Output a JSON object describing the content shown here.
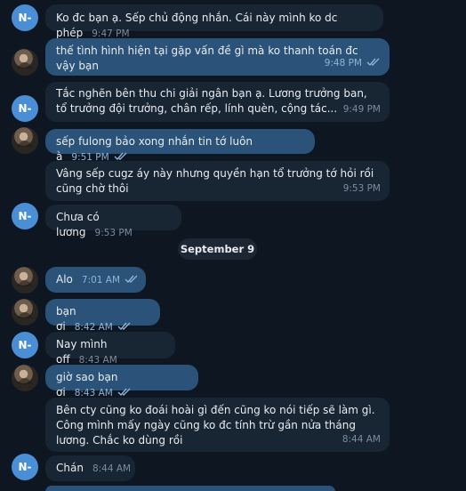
{
  "messages": [
    {
      "sender": "N-",
      "text": "Ko đc bạn ạ. Sếp chủ động nhắn. Cái này mình ko dc phép",
      "time": "9:47 PM"
    },
    {
      "sender": "me",
      "text": "thế tình hình hiện tại gặp vấn đề gì mà ko thanh toán đc vậy bạn",
      "time": "9:48 PM",
      "status": "read"
    },
    {
      "sender": "N-",
      "text": "Tắc nghẽn bên thu chi giải ngân bạn ạ. Lương trưởng ban, tổ trưởng đội trưởng, chân rếp, lính quèn, cộng tác...",
      "time": "9:49 PM"
    },
    {
      "sender": "me",
      "text": "sếp fulong bảo xong nhắn tin tớ luôn à",
      "time": "9:51 PM",
      "status": "read"
    },
    {
      "sender": "N-",
      "text": "Vâng sếp cugz áy này nhưng quyền hạn tổ trưởng tớ hỏi rồi cũng chờ thôi",
      "time": "9:53 PM"
    },
    {
      "sender": "N-",
      "text": "Chưa có lương",
      "time": "9:53 PM"
    },
    {
      "sender": "me",
      "text": "Alo",
      "time": "7:01 AM",
      "status": "read"
    },
    {
      "sender": "me",
      "text": "bạn ơi",
      "time": "8:42 AM",
      "status": "read"
    },
    {
      "sender": "N-",
      "text": "Nay mình off",
      "time": "8:43 AM"
    },
    {
      "sender": "me",
      "text": "giờ sao bạn ơi",
      "time": "8:43 AM",
      "status": "read"
    },
    {
      "sender": "N-",
      "text": "Bên cty cũng ko đoái hoài gì đến cũng ko nói tiếp sẽ làm gì. Công mình mấy ngày cũng ko đc tính trừ gần nửa tháng lương. Chắc ko dùng rồi",
      "time": "8:44 AM"
    },
    {
      "sender": "N-",
      "text": "Chán",
      "time": "8:44 AM"
    }
  ],
  "date_separator": "September 9",
  "avatar_initials": "N-",
  "colors": {
    "background": "#0e1621",
    "incoming_bubble": "#182533",
    "outgoing_bubble": "#2b5278",
    "avatar_blue": "#4a8fd6",
    "read_ticks": "#8fb4d8"
  },
  "icons": [
    "double-check-icon",
    "avatar-photo"
  ]
}
